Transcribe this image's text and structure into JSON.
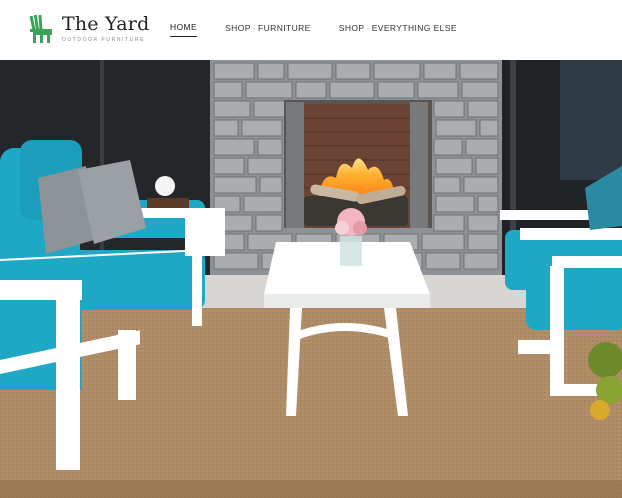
{
  "brand": {
    "name": "The Yard",
    "tagline": "Outdoor Furniture",
    "logo_icon": "adirondack-chair-icon",
    "logo_color": "#3aa35a"
  },
  "nav": {
    "items": [
      {
        "label": "HOME",
        "active": true
      },
      {
        "prefix": "SHOP",
        "separator": "-",
        "label": "FURNITURE",
        "active": false
      },
      {
        "prefix": "SHOP",
        "separator": "-",
        "label": "EVERYTHING ELSE",
        "active": false
      }
    ]
  },
  "colors": {
    "cushion": "#1fa7c6",
    "frame": "#ffffff",
    "rug": "#b08e68",
    "stone": "#8d9296",
    "nav_separator": "#b9a96a"
  }
}
